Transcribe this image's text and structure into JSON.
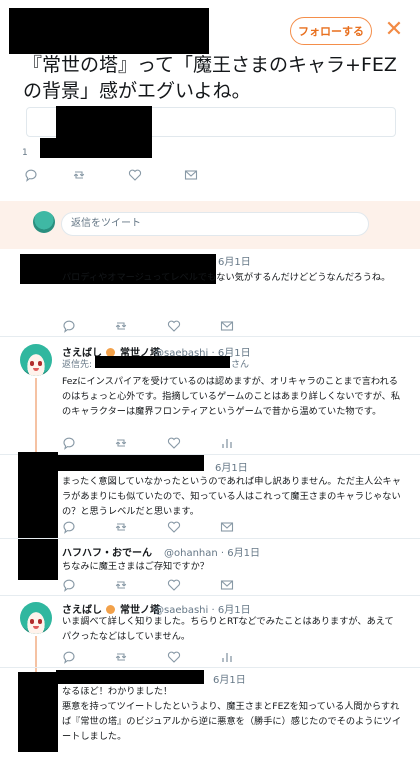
{
  "header": {
    "follow_label": "フォローする",
    "close_glyph": "✕"
  },
  "main_tweet": {
    "text": "『常世の塔』って「魔王さまのキャラ+FEZの背景」感がエグいよね。",
    "count_partial": "1"
  },
  "reply_box": {
    "placeholder": "返信をツイート"
  },
  "replies": [
    {
      "date": "6月1日",
      "text": "パロディやオマージュってレベルでもない気がするんだけどどうなんだろうね。"
    },
    {
      "name": "さえばし",
      "name_suffix": "常世ノ塔",
      "handle": "@saebashi",
      "date": "6月1日",
      "reply_to_label": "返信先:",
      "reply_to_suffix": "さん",
      "text": "Fezにインスパイアを受けているのは認めますが、オリキャラのことまで言われるのはちょっと心外です。指摘しているゲームのことはあまり詳しくないですが、私のキャラクターは魔界フロンティアというゲームで昔から温めていた物です。"
    },
    {
      "date": "6月1日",
      "text": "まったく意図していなかったというのであれば申し訳ありません。ただ主人公キャラがあまりにも似ていたので、知っている人はこれって魔王さまのキャラじゃないの？と思うレベルだと思います。"
    },
    {
      "name": "ハフハフ・おでーん",
      "handle": "@ohanhan",
      "date": "6月1日",
      "text": "ちなみに魔王さまはご存知ですか？"
    },
    {
      "name": "さえばし",
      "name_suffix": "常世ノ塔",
      "handle": "@saebashi",
      "date": "6月1日",
      "text": "いま調べて詳しく知りました。ちらりとRTなどでみたことはありますが、あえてパクったなどはしていません。"
    },
    {
      "date": "6月1日",
      "text": "なるほど！わかりました！\n悪意を持ってツイートしたというより、魔王さまとFEZを知っている人間からすれば『常世の塔』のビジュアルから逆に悪意を（勝手に）感じたのでそのようにツイートしました。"
    }
  ],
  "icons": [
    "reply-icon",
    "retweet-icon",
    "like-icon",
    "dm-icon",
    "analytics-icon"
  ],
  "colors": {
    "accent": "#e8701f",
    "text": "#14171a",
    "muted": "#657786",
    "thread": "#f5c2a3",
    "reply_band": "#fdf1ea"
  }
}
